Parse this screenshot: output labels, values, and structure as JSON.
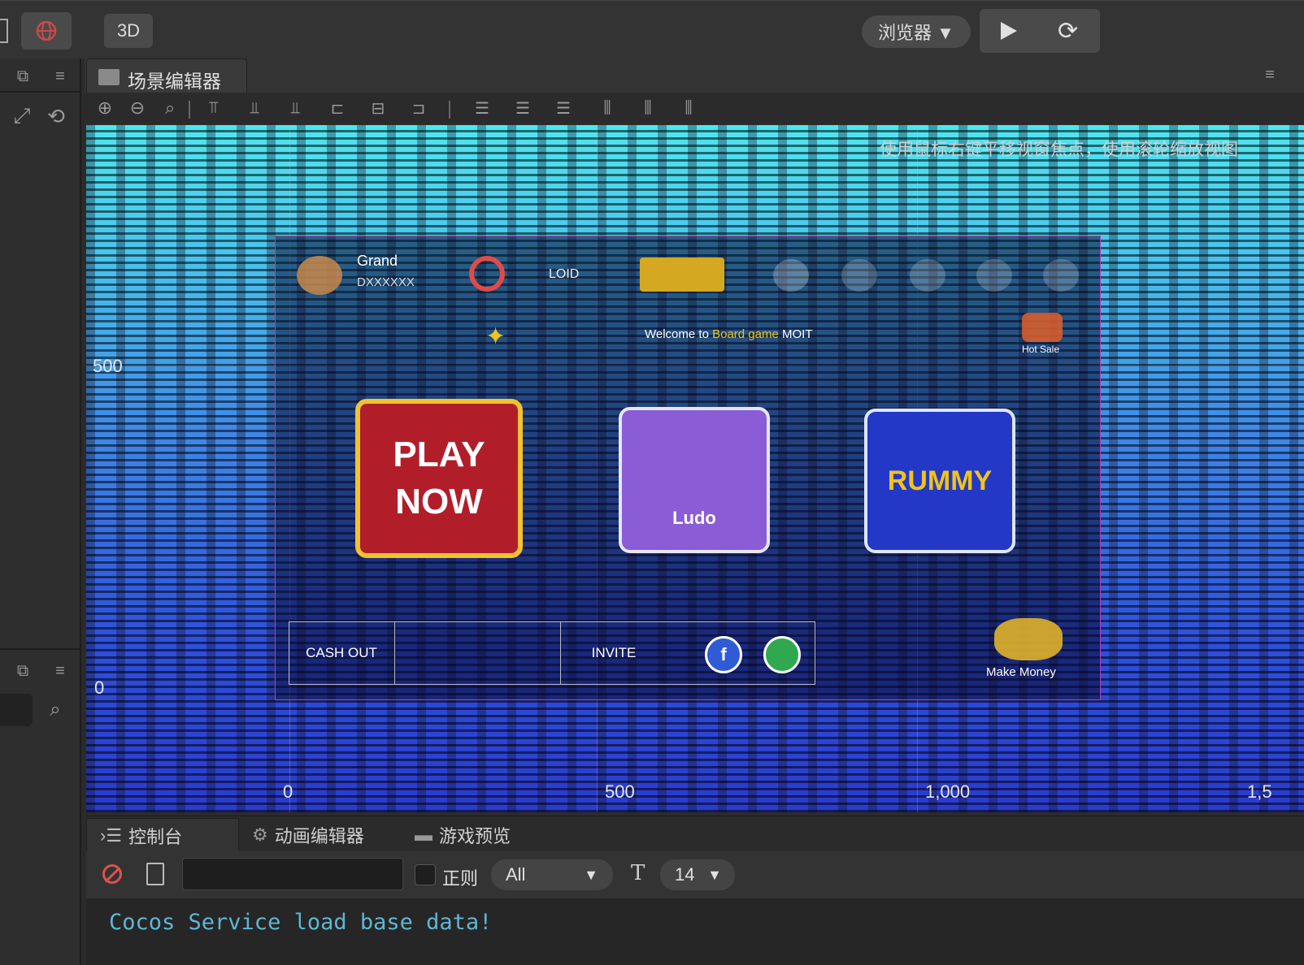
{
  "toolbar": {
    "mode_3d": "3D",
    "browser_select": "浏览器 ▼"
  },
  "scene_panel": {
    "tab_label": "场景编辑器",
    "hint": "使用鼠标右键平移视窗焦点，使用滚轮缩放视图",
    "y_axis": [
      "500",
      "0"
    ],
    "x_axis": [
      "0",
      "500",
      "1,000",
      "1,5"
    ]
  },
  "game_ui": {
    "top_left_text": "Grand",
    "top_left_sub": "DXXXXXX",
    "top_text": "LOID",
    "welcome": "Welcome to",
    "welcome_highlight": "Board game",
    "welcome_tail": "MOIT",
    "hot_label": "Hot Sale",
    "card1_line1": "PLAY",
    "card1_line2": "NOW",
    "card2_label": "Ludo",
    "card3_line1": "RUMMY",
    "cash_out": "CASH OUT",
    "invite": "INVITE",
    "make_money": "Make Money"
  },
  "console": {
    "tabs": [
      "控制台",
      "动画编辑器",
      "游戏预览"
    ],
    "regex_label": "正则",
    "filter_value": "All",
    "font_size": "14",
    "output": "Cocos Service load base data!"
  },
  "colors": {
    "console_text": "#5fb6d4",
    "danger": "#d9534f",
    "accent_gold": "#f0c419"
  }
}
